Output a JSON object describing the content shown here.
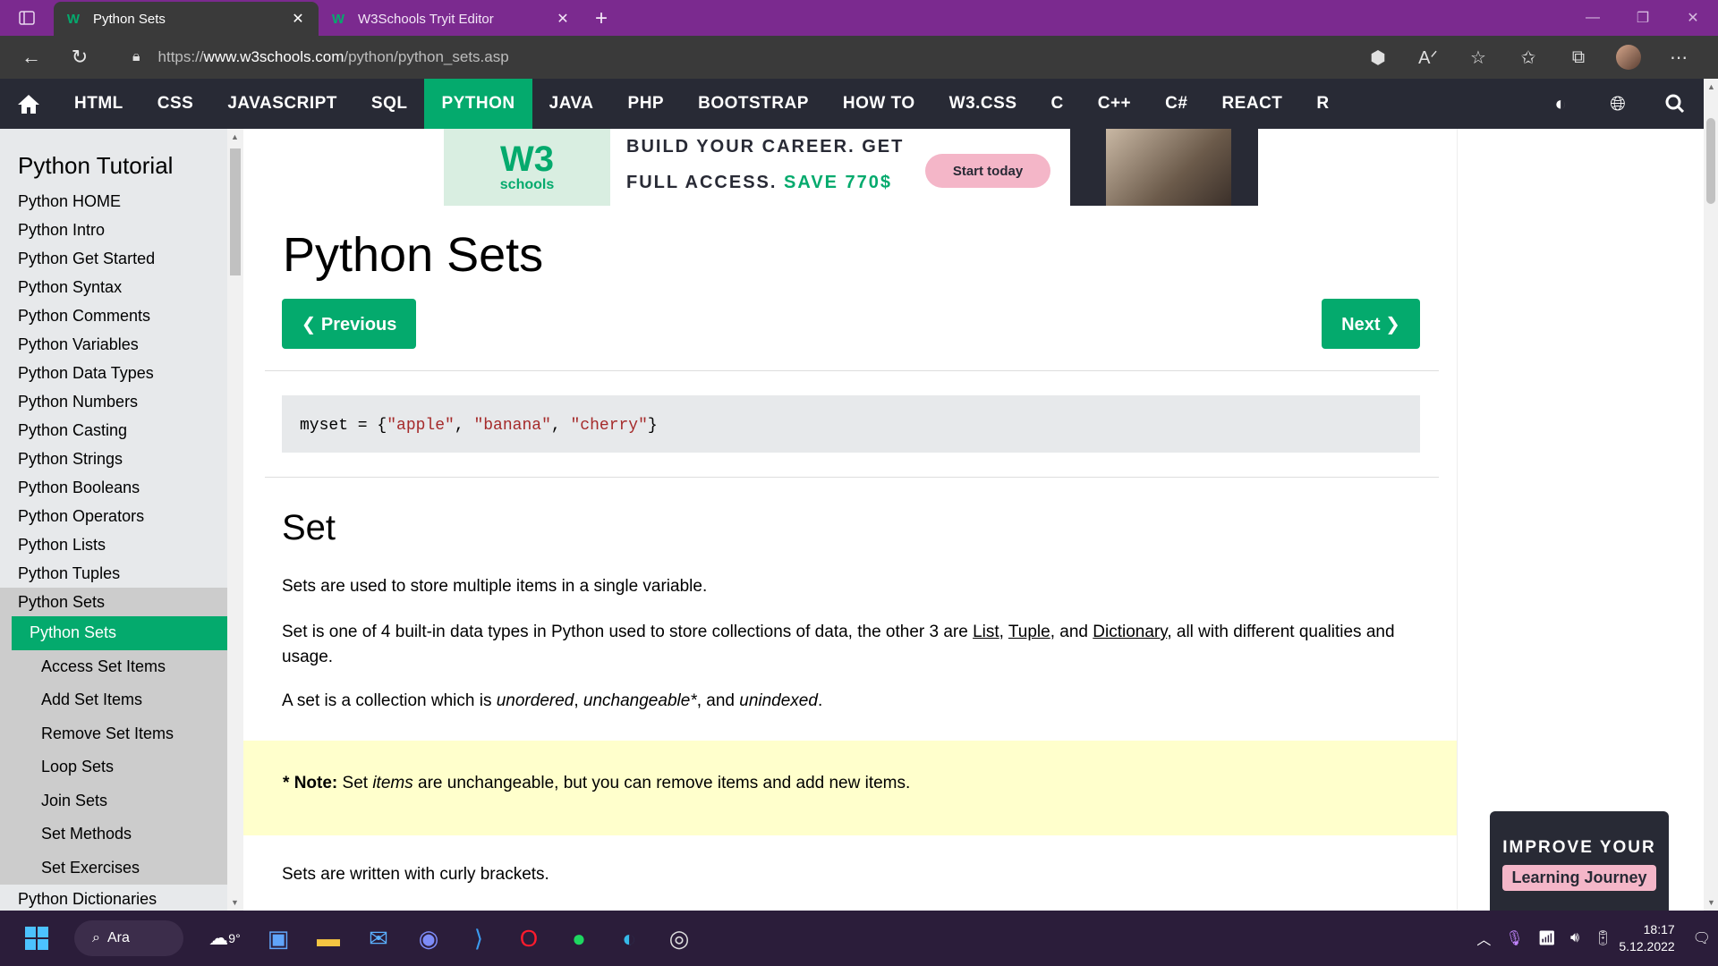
{
  "browser": {
    "tabs": [
      {
        "title": "Python Sets",
        "favicon": "W",
        "active": true
      },
      {
        "title": "W3Schools Tryit Editor",
        "favicon": "W",
        "active": false
      }
    ],
    "new_tab": "+",
    "url_prefix": "https://",
    "url_host": "www.w3schools.com",
    "url_path": "/python/python_sets.asp"
  },
  "topnav": {
    "items": [
      "HTML",
      "CSS",
      "JAVASCRIPT",
      "SQL",
      "PYTHON",
      "JAVA",
      "PHP",
      "BOOTSTRAP",
      "HOW TO",
      "W3.CSS",
      "C",
      "C++",
      "C#",
      "REACT",
      "R"
    ],
    "active": "PYTHON"
  },
  "sidebar": {
    "title": "Python Tutorial",
    "items": [
      "Python HOME",
      "Python Intro",
      "Python Get Started",
      "Python Syntax",
      "Python Comments",
      "Python Variables",
      "Python Data Types",
      "Python Numbers",
      "Python Casting",
      "Python Strings",
      "Python Booleans",
      "Python Operators",
      "Python Lists",
      "Python Tuples",
      "Python Sets"
    ],
    "subitems": [
      "Python Sets",
      "Access Set Items",
      "Add Set Items",
      "Remove Set Items",
      "Loop Sets",
      "Join Sets",
      "Set Methods",
      "Set Exercises"
    ],
    "after": "Python Dictionaries"
  },
  "ad": {
    "logo_w3": "W3",
    "logo_schools": "schools",
    "line1": "BUILD YOUR CAREER. GET",
    "line2a": "FULL ACCESS.",
    "line2b": "SAVE 770$",
    "cta": "Start today"
  },
  "main": {
    "title": "Python Sets",
    "prev": "❮ Previous",
    "next": "Next ❯",
    "code_prefix": "myset = {",
    "code_s1": "\"apple\"",
    "code_s2": "\"banana\"",
    "code_s3": "\"cherry\"",
    "code_suffix": "}",
    "code_sep": ", ",
    "h2": "Set",
    "p1": "Sets are used to store multiple items in a single variable.",
    "p2_a": "Set is one of 4 built-in data types in Python used to store collections of data, the other 3 are ",
    "p2_list": "List",
    "p2_sep1": ", ",
    "p2_tuple": "Tuple",
    "p2_sep2": ", and ",
    "p2_dict": "Dictionary",
    "p2_b": ", all with different qualities and usage.",
    "p3_a": "A set is a collection which is ",
    "p3_i1": "unordered",
    "p3_sep1": ", ",
    "p3_i2": "unchangeable*",
    "p3_sep2": ", and ",
    "p3_i3": "unindexed",
    "p3_end": ".",
    "note_star": "* ",
    "note_label": "Note:",
    "note_a": " Set ",
    "note_i": "items",
    "note_b": " are unchangeable, but you can remove items and add new items.",
    "p4": "Sets are written with curly brackets."
  },
  "promo": {
    "line1": "IMPROVE YOUR",
    "line2": "Learning Journey"
  },
  "taskbar": {
    "search": "Ara",
    "weather": "9°",
    "time": "18:17",
    "date": "5.12.2022"
  },
  "colors": {
    "accent": "#04aa6d",
    "nav_bg": "#282a35",
    "browser_frame": "#7b2a8f",
    "note_bg": "#ffffcc",
    "sidebar_bg": "#e7e9eb"
  }
}
